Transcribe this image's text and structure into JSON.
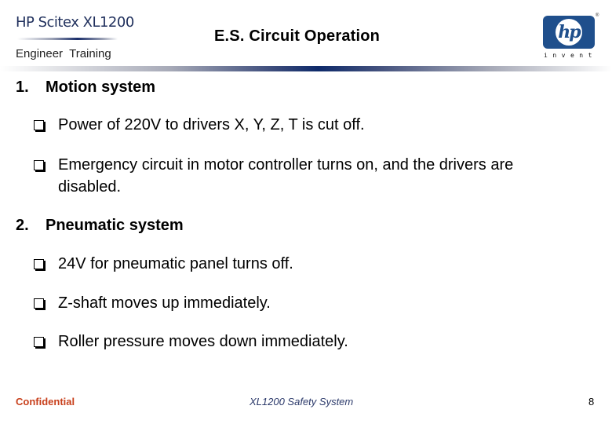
{
  "header": {
    "brand": "HP Scitex XL1200",
    "subtitle": "Engineer  Training",
    "title": "E.S. Circuit Operation",
    "logo": {
      "text": "hp",
      "tagline": "invent",
      "registered": "®",
      "color": "#1f4f8c"
    }
  },
  "sections": [
    {
      "number": "1.",
      "title": "Motion system",
      "bullets": [
        "Power of 220V to drivers X, Y, Z, T is cut off.",
        "Emergency circuit in motor controller turns on, and the drivers are disabled."
      ]
    },
    {
      "number": "2.",
      "title": "Pneumatic system",
      "bullets": [
        "24V for pneumatic panel turns off.",
        "Z-shaft moves up immediately.",
        "Roller pressure moves down immediately."
      ]
    }
  ],
  "bullet_icon": "checkbox-square-icon",
  "footer": {
    "confidential": "Confidential",
    "center": "XL1200 Safety System",
    "page_number": "8",
    "confidential_color": "#c8401c",
    "center_color": "#2c3a6b"
  }
}
